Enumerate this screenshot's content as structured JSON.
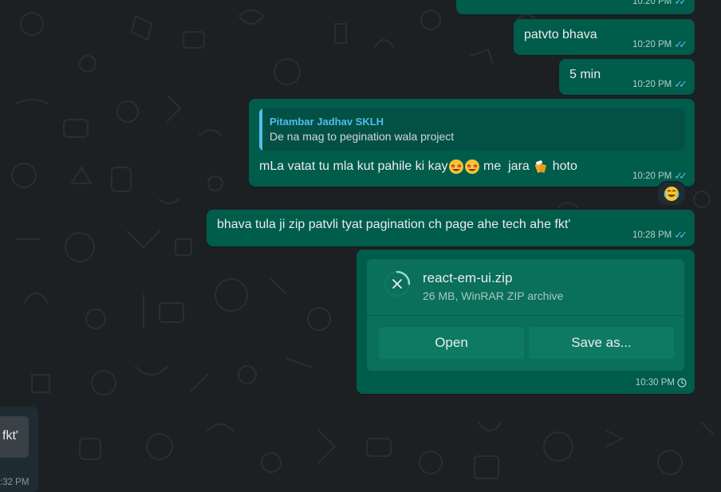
{
  "colors": {
    "background": "#1d2023",
    "outgoing_bubble": "#005c4b",
    "quote_bar": "#53bdeb",
    "read_ticks": "#53bdeb"
  },
  "messages": [
    {
      "text": "",
      "time": "10:20 PM",
      "status": "read"
    },
    {
      "text": "patvto bhava",
      "time": "10:20 PM",
      "status": "read"
    },
    {
      "text": "5 min",
      "time": "10:20 PM",
      "status": "read"
    },
    {
      "quote_author": "Pitambar Jadhav SKLH",
      "quote_text": "De na mag to pegination wala project",
      "text_part1": "mLa vatat tu mla kut pahile ki kay",
      "text_part2": " me  jara ",
      "text_part3": " hoto",
      "time": "10:20 PM",
      "status": "read",
      "reaction": "face-with-tears-of-joy"
    },
    {
      "text": "bhava tula ji zip patvli tyat pagination ch page ahe tech ahe fkt'",
      "time": "10:28 PM",
      "status": "read"
    }
  ],
  "file_message": {
    "file_name": "react-em-ui.zip",
    "file_info": "26 MB, WinRAR ZIP archive",
    "open_label": "Open",
    "save_label": "Save as...",
    "time": "10:30 PM",
    "status": "pending"
  },
  "incoming_partial": {
    "text": "fkt'",
    "time": ":32 PM"
  },
  "icons": {
    "cancel_download": "close-icon",
    "pending_status": "clock-icon",
    "read_status": "double-check-icon"
  }
}
